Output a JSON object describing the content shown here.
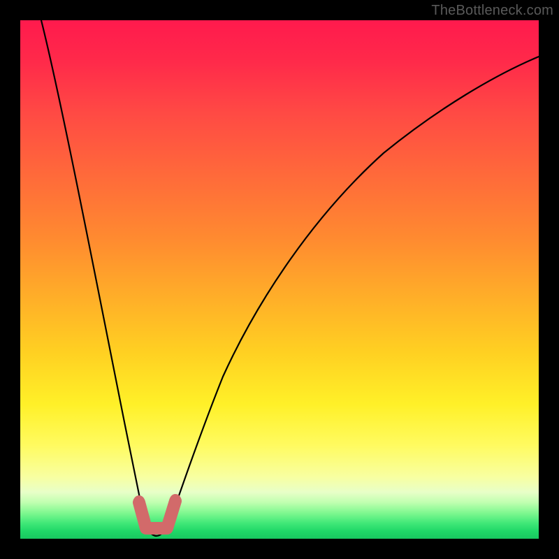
{
  "watermark": {
    "text": "TheBottleneck.com"
  },
  "colors": {
    "frame_bg": "#000000",
    "curve_stroke": "#000000",
    "near_optimal_stroke": "#d86a6a"
  },
  "chart_data": {
    "type": "line",
    "title": "",
    "xlabel": "",
    "ylabel": "",
    "xlim": [
      0,
      100
    ],
    "ylim": [
      0,
      100
    ],
    "grid": false,
    "legend": false,
    "series": [
      {
        "name": "bottleneck-curve",
        "x": [
          4,
          6,
          8,
          10,
          12,
          14,
          16,
          18,
          20,
          22,
          23,
          24,
          25,
          26,
          27,
          28,
          30,
          33,
          37,
          42,
          48,
          55,
          63,
          72,
          82,
          92,
          100
        ],
        "y": [
          100,
          91,
          82,
          73,
          64,
          55,
          46,
          36,
          25,
          13,
          7,
          2,
          0,
          0,
          2,
          7,
          18,
          30,
          41,
          50,
          58,
          64,
          69,
          73,
          77,
          80,
          82
        ]
      },
      {
        "name": "near-optimal-band",
        "x": [
          22.5,
          23,
          24,
          25,
          26,
          27,
          27.5
        ],
        "y": [
          6,
          3,
          1,
          0,
          1,
          3,
          6
        ]
      }
    ]
  }
}
